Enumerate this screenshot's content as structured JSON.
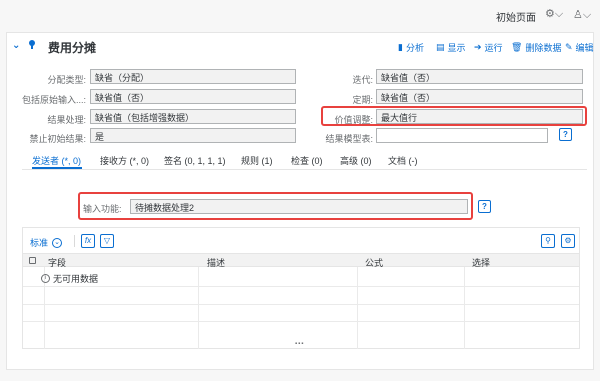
{
  "shell": {
    "home_label": "初始页面",
    "settings_icon": "gear-icon",
    "user_icon": "person-icon"
  },
  "header": {
    "title": "费用分摊",
    "actions": {
      "analyze": "分析",
      "show": "显示",
      "run": "运行",
      "delete_data": "删除数据",
      "edit": "编辑"
    }
  },
  "form": {
    "left": [
      {
        "label": "分配类型:",
        "value": "缺省（分配）"
      },
      {
        "label": "包括原始输入...:",
        "value": "缺省值（否）"
      },
      {
        "label": "结果处理:",
        "value": "缺省值（包括增强数据）"
      },
      {
        "label": "禁止初始结果:",
        "value": "是"
      }
    ],
    "right": [
      {
        "label": "迭代:",
        "value": "缺省值（否）"
      },
      {
        "label": "定期:",
        "value": "缺省值（否）"
      },
      {
        "label": "价值调整:",
        "value": "最大值行"
      },
      {
        "label": "结果模型表:",
        "value": ""
      }
    ]
  },
  "tabs": [
    {
      "label": "发送者 (*, 0)",
      "active": true
    },
    {
      "label": "接收方 (*, 0)"
    },
    {
      "label": "签名 (0, 1, 1, 1)"
    },
    {
      "label": "规则 (1)"
    },
    {
      "label": "检查 (0)"
    },
    {
      "label": "高级 (0)"
    },
    {
      "label": "文档 (-)"
    }
  ],
  "sender": {
    "input_function_label": "输入功能:",
    "input_function_value": "待摊数据处理2"
  },
  "table": {
    "variant_label": "标准",
    "columns": [
      "字段",
      "描述",
      "公式",
      "选择"
    ],
    "no_data": "无可用数据"
  },
  "colors": {
    "accent": "#0a6ed1",
    "highlight": "#e8413e"
  }
}
